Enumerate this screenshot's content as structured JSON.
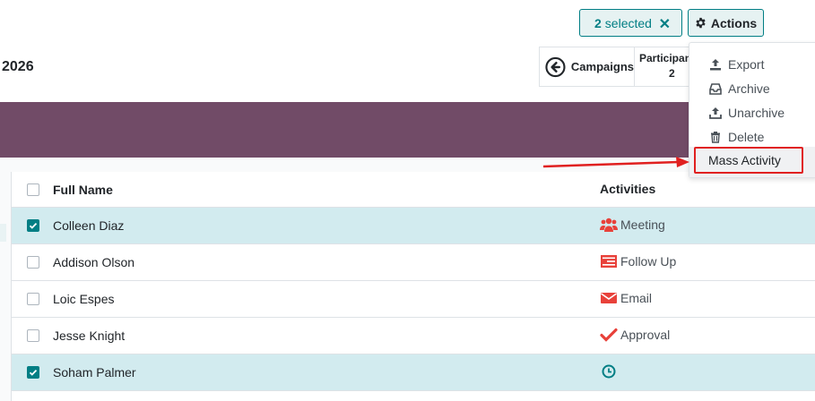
{
  "header": {
    "title_fragment": "2026",
    "selected_count": "2",
    "selected_label": "selected",
    "actions_label": "Actions"
  },
  "smart_buttons": {
    "campaigns_label": "Campaigns",
    "participants_label": "Participan",
    "participants_value": "2"
  },
  "actions_menu": {
    "items": [
      {
        "label": "Export",
        "icon": "upload-icon"
      },
      {
        "label": "Archive",
        "icon": "inbox-icon"
      },
      {
        "label": "Unarchive",
        "icon": "upload-icon"
      },
      {
        "label": "Delete",
        "icon": "trash-icon"
      },
      {
        "label": "Mass Activity",
        "icon": ""
      }
    ]
  },
  "table": {
    "columns": [
      "Full Name",
      "Activities"
    ],
    "rows": [
      {
        "name": "Colleen Diaz",
        "activity": "Meeting",
        "activity_icon": "users-icon",
        "selected": true
      },
      {
        "name": "Addison Olson",
        "activity": "Follow Up",
        "activity_icon": "tasks-icon",
        "selected": false
      },
      {
        "name": "Loic Espes",
        "activity": "Email",
        "activity_icon": "envelope-icon",
        "selected": false
      },
      {
        "name": "Jesse Knight",
        "activity": "Approval",
        "activity_icon": "check-icon",
        "selected": false
      },
      {
        "name": "Soham Palmer",
        "activity": "",
        "activity_icon": "clock-icon",
        "selected": true
      }
    ]
  },
  "colors": {
    "brand_purple": "#714b67",
    "accent_teal": "#017e84",
    "danger_red": "#e02020",
    "activity_red": "#e8413a"
  }
}
